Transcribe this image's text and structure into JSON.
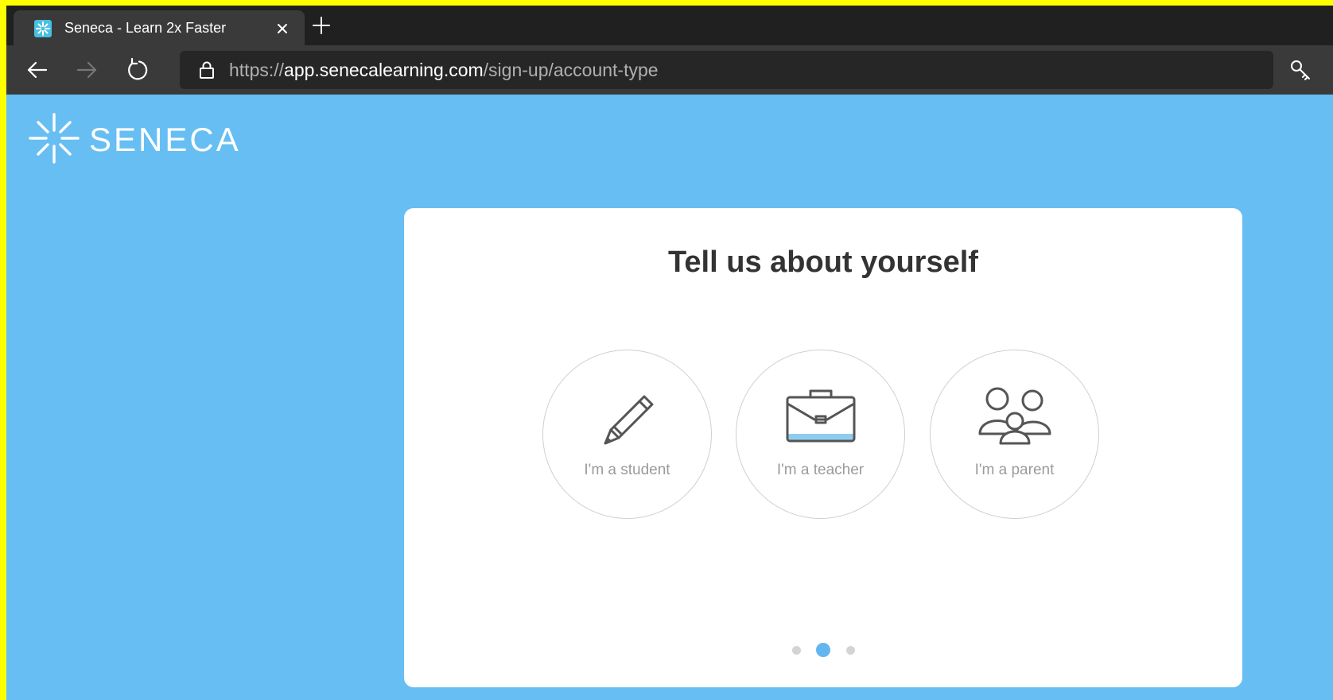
{
  "browser": {
    "tab_title": "Seneca - Learn 2x Faster",
    "url_scheme": "https://",
    "url_host": "app.senecalearning.com",
    "url_path": "/sign-up/account-type"
  },
  "brand": {
    "logo_text": "SENECA"
  },
  "signup": {
    "heading": "Tell us about yourself",
    "options": [
      {
        "label": "I'm a student",
        "icon": "pencil-icon"
      },
      {
        "label": "I'm a teacher",
        "icon": "briefcase-icon"
      },
      {
        "label": "I'm a parent",
        "icon": "family-icon"
      }
    ],
    "pagination": {
      "total": 3,
      "active_index": 1
    }
  },
  "colors": {
    "page_background": "#67bef3",
    "accent": "#62b6ef",
    "frame": "#ffff00"
  }
}
